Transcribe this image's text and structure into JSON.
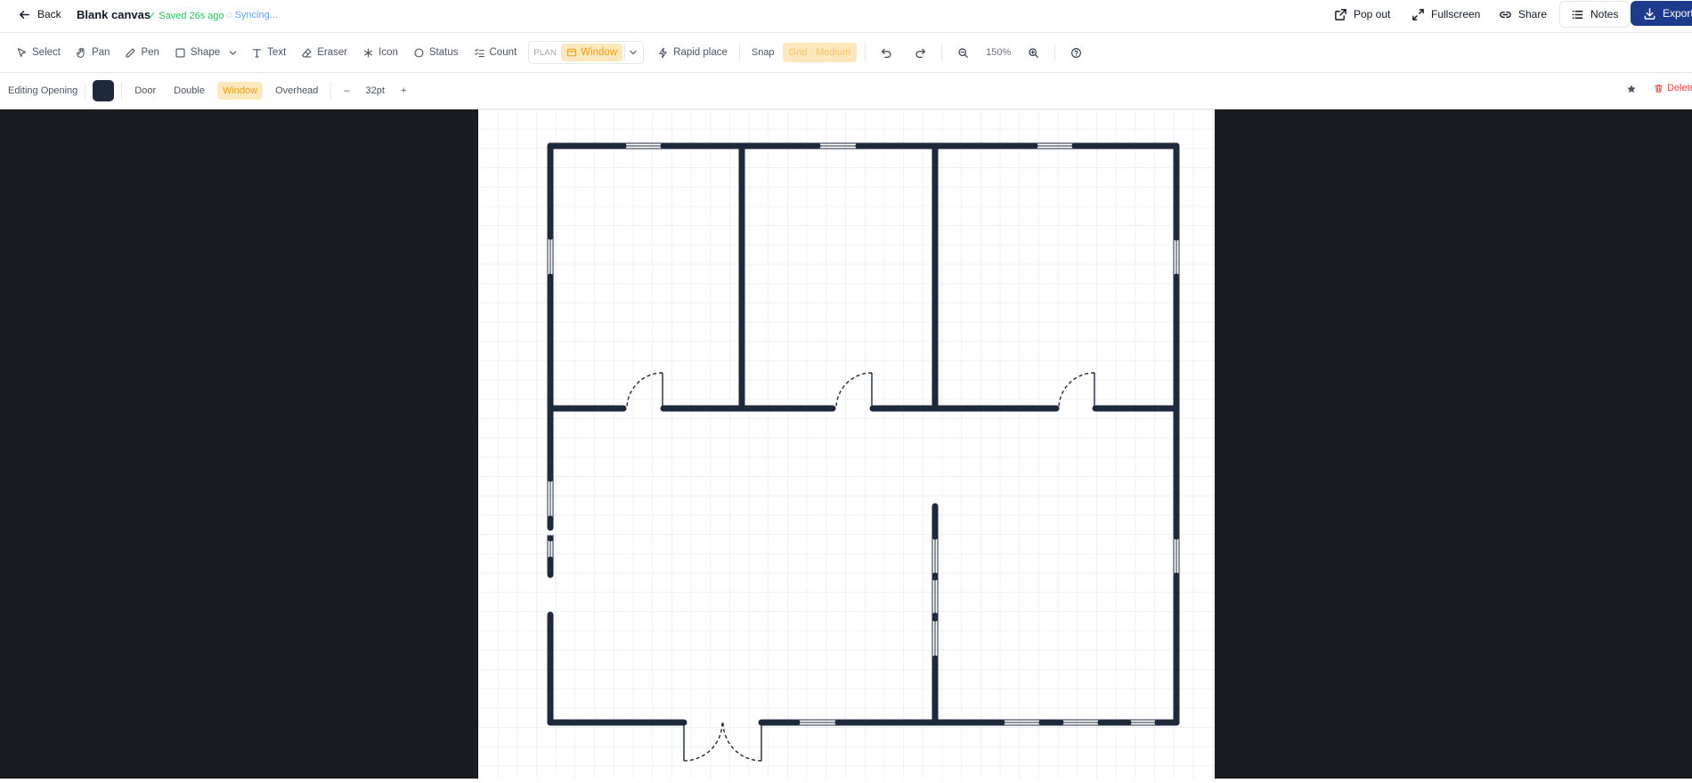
{
  "header": {
    "back_label": "Back",
    "doc_title": "Blank canvas",
    "saved_status": "✓ Saved 26s ago",
    "sync_status": "◌ Syncing...",
    "popout_label": "Pop out",
    "fullscreen_label": "Fullscreen",
    "share_label": "Share",
    "notes_label": "Notes",
    "export_label": "Export"
  },
  "toolbar": {
    "select": "Select",
    "pan": "Pan",
    "pen": "Pen",
    "shape": "Shape",
    "text": "Text",
    "eraser": "Eraser",
    "icon": "Icon",
    "status": "Status",
    "count": "Count",
    "plan_tag": "PLAN",
    "window_tool": "Window",
    "rapid_place": "Rapid place",
    "snap": "Snap",
    "grid": "Grid · Medium",
    "zoom": "150%"
  },
  "props": {
    "editing_label": "Editing Opening",
    "color": "#1e293b",
    "types": [
      "Door",
      "Double",
      "Window",
      "Overhead"
    ],
    "active_type": "Window",
    "minus": "–",
    "size": "32pt",
    "plus": "+",
    "delete_label": "Delete"
  },
  "colors": {
    "accent": "#1e3a8a",
    "active_bg": "#fde7bd",
    "active_fg": "#f59e0b",
    "saved": "#22c55e",
    "syncing": "#60a5fa",
    "wall": "#1e293b",
    "delete": "#ef4444"
  }
}
